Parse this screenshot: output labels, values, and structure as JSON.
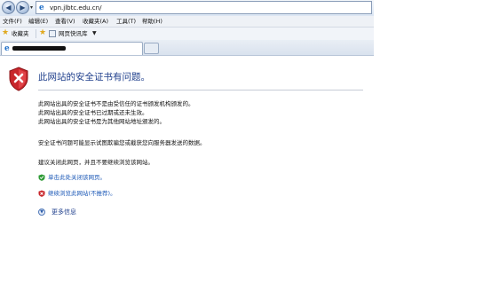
{
  "address_bar": {
    "url": "vpn.jlbtc.edu.cn/",
    "icon": "ie-page-icon"
  },
  "menu": [
    {
      "label": "文件(F)"
    },
    {
      "label": "编辑(E)"
    },
    {
      "label": "查看(V)"
    },
    {
      "label": "收藏夹(A)"
    },
    {
      "label": "工具(T)"
    },
    {
      "label": "帮助(H)"
    }
  ],
  "favorites_bar": {
    "favorites_label": "收藏夹",
    "quick_link_label": "网页快讯库"
  },
  "error_page": {
    "title": "此网站的安全证书有问题。",
    "reasons": [
      "此网站出具的安全证书不是由受信任的证书颁发机构颁发的。",
      "此网站出具的安全证书已过期或还未生效。",
      "此网站出具的安全证书是为其他网站地址颁发的。"
    ],
    "explanation": "安全证书问题可能显示试图欺骗您或截获您向服务器发送的数据。",
    "recommendation": "建议关闭此网页，并且不要继续浏览该网站。",
    "close_link": "单击此处关闭该网页。",
    "continue_link": "继续浏览此网站(不推荐)。",
    "more_info": "更多信息",
    "colors": {
      "title": "#1f3f8c",
      "link": "#1a57b6",
      "shield": "#c8262b"
    }
  }
}
